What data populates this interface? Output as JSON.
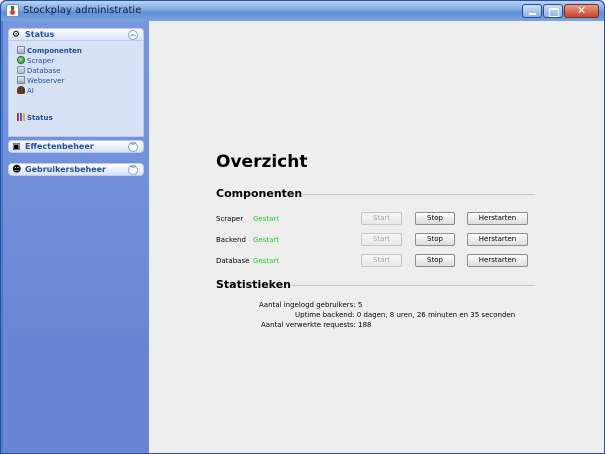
{
  "window": {
    "title": "Stockplay administratie"
  },
  "sidebar": {
    "panels": [
      {
        "label": "Status",
        "icon": "gear-icon",
        "items": [
          {
            "label": "Componenten",
            "icon": "server-icon",
            "selected": true
          },
          {
            "label": "Scraper",
            "icon": "globe-icon"
          },
          {
            "label": "Database",
            "icon": "database-icon"
          },
          {
            "label": "Webserver",
            "icon": "server-icon"
          },
          {
            "label": "AI",
            "icon": "ai-icon"
          },
          {
            "label": "Status",
            "icon": "bar-chart-icon",
            "selected": true
          }
        ]
      },
      {
        "label": "Effectenbeheer",
        "icon": "stocks-icon"
      },
      {
        "label": "Gebruikersbeheer",
        "icon": "user-icon"
      }
    ]
  },
  "main": {
    "heading": "Overzicht",
    "components": {
      "title": "Componenten",
      "rows": [
        {
          "name": "Scraper",
          "status": "Gestart",
          "start": "Start",
          "stop": "Stop",
          "restart": "Herstarten"
        },
        {
          "name": "Backend",
          "status": "Gestart",
          "start": "Start",
          "stop": "Stop",
          "restart": "Herstarten"
        },
        {
          "name": "Database",
          "status": "Gestart",
          "start": "Start",
          "stop": "Stop",
          "restart": "Herstarten"
        }
      ]
    },
    "statistics": {
      "title": "Statistieken",
      "lines": [
        "Aantal ingelogd gebruikers: 5",
        "Uptime backend: 0 dagen, 8 uren, 26 minuten en 35 seconden",
        "Aantal verwerkte requests: 188"
      ]
    }
  },
  "colors": {
    "status_started": "#22cc22",
    "sidebar_background": "#7897e0",
    "panel_text": "#214d9f"
  }
}
